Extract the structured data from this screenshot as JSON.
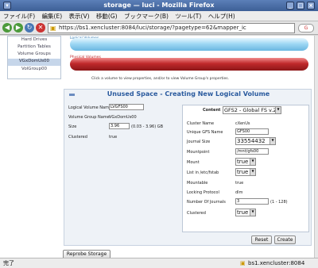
{
  "window": {
    "title": "storage — luci - Mozilla Firefox"
  },
  "menu": [
    "ファイル(F)",
    "編集(E)",
    "表示(V)",
    "移動(G)",
    "ブックマーク(B)",
    "ツール(T)",
    "ヘルプ(H)"
  ],
  "nav": {
    "url": "https://bs1.xencluster:8084/luci/storage/?pagetype=62&mapper_ic"
  },
  "sidebar": {
    "items": [
      "Hard Drives",
      "Partition Tables",
      "Volume Groups",
      "VGxDomUs00",
      "VolGroup00"
    ]
  },
  "volumes": {
    "logical_label": "Logical Volumes",
    "physical_label": "Physical Volumes",
    "caption": "Click a volume to view properties, and/or to view Volume Group's properties."
  },
  "form": {
    "title": "Unused Space - Creating New Logical Volume",
    "lv_name_label": "Logical Volume Name",
    "lv_name_value": "LVGFS00",
    "vg_name_label": "Volume Group Name",
    "vg_name_value": "VGxDomUs00",
    "size_label": "Size",
    "size_value": "3.96",
    "size_range": "(0.03 - 3.96) GB",
    "clustered_label": "Clustered",
    "clustered_value": "true"
  },
  "content": {
    "label": "Content",
    "type": "GFS2 - Global FS v.2",
    "cluster_name_label": "Cluster Name",
    "cluster_name_value": "cXenUs",
    "fs_name_label": "Unique GFS Name",
    "fs_name_value": "GFS00",
    "journal_size_label": "Journal Size",
    "journal_size_value": "33554432",
    "mountpoint_label": "Mountpoint",
    "mountpoint_value": "/mnt/gfs00",
    "mount_label": "Mount",
    "mount_value": "true",
    "fstab_label": "List in /etc/fstab",
    "fstab_value": "true",
    "mountable_label": "Mountable",
    "mountable_value": "true",
    "locking_label": "Locking Protocol",
    "locking_value": "dlm",
    "journals_label": "Number Of Journals",
    "journals_value": "3",
    "journals_range": "(1 - 128)",
    "clustered_label": "Clustered",
    "clustered_value": "true"
  },
  "buttons": {
    "reset": "Reset",
    "create": "Create",
    "reprobe": "Reprobe Storage"
  },
  "status": {
    "left": "完了",
    "right": "bs1.xencluster:8084"
  },
  "colors": {
    "logical": "#8fd0f0",
    "physical": "#c0292b",
    "accent": "#2a5a9e"
  }
}
